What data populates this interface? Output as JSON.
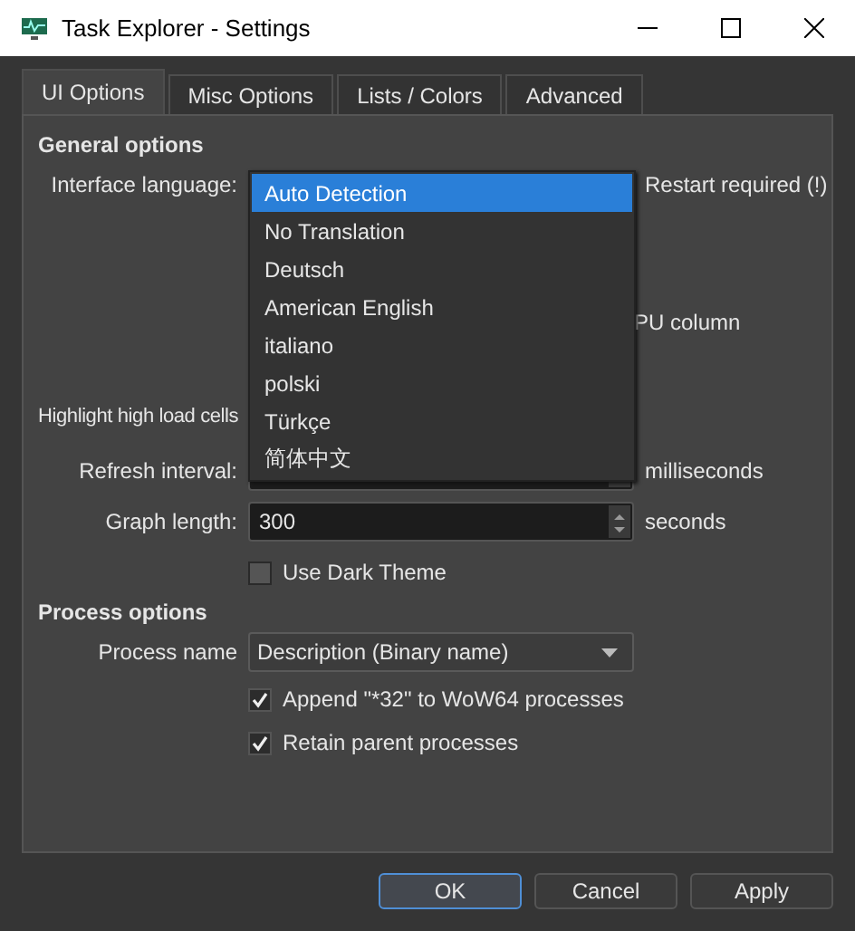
{
  "window": {
    "title": "Task Explorer - Settings"
  },
  "tabs": [
    {
      "label": "UI Options",
      "selected": true
    },
    {
      "label": "Misc Options",
      "selected": false
    },
    {
      "label": "Lists / Colors",
      "selected": false
    },
    {
      "label": "Advanced",
      "selected": false
    }
  ],
  "general": {
    "heading": "General options",
    "language_label": "Interface language:",
    "language_note": "Restart required (!)",
    "cpu_column_text": "PU column",
    "highlight_label": "Highlight high load cells",
    "refresh_label": "Refresh interval:",
    "refresh_unit": "milliseconds",
    "graph_label": "Graph length:",
    "graph_value": "300",
    "graph_unit": "seconds",
    "dark_theme": {
      "label": "Use Dark Theme",
      "checked": false
    }
  },
  "process": {
    "heading": "Process options",
    "name_label": "Process name",
    "name_value": "Description (Binary name)",
    "checks": [
      {
        "label": "Append \"*32\" to WoW64 processes",
        "checked": true
      },
      {
        "label": "Retain parent processes",
        "checked": true
      }
    ]
  },
  "language_menu": [
    {
      "label": "Auto Detection",
      "selected": true
    },
    {
      "label": "No Translation",
      "selected": false
    },
    {
      "label": "Deutsch",
      "selected": false
    },
    {
      "label": "American English",
      "selected": false
    },
    {
      "label": "italiano",
      "selected": false
    },
    {
      "label": "polski",
      "selected": false
    },
    {
      "label": "Türkçe",
      "selected": false
    },
    {
      "label": "简体中文",
      "selected": false
    }
  ],
  "buttons": [
    {
      "label": "OK",
      "default": true
    },
    {
      "label": "Cancel",
      "default": false
    },
    {
      "label": "Apply",
      "default": false
    }
  ]
}
